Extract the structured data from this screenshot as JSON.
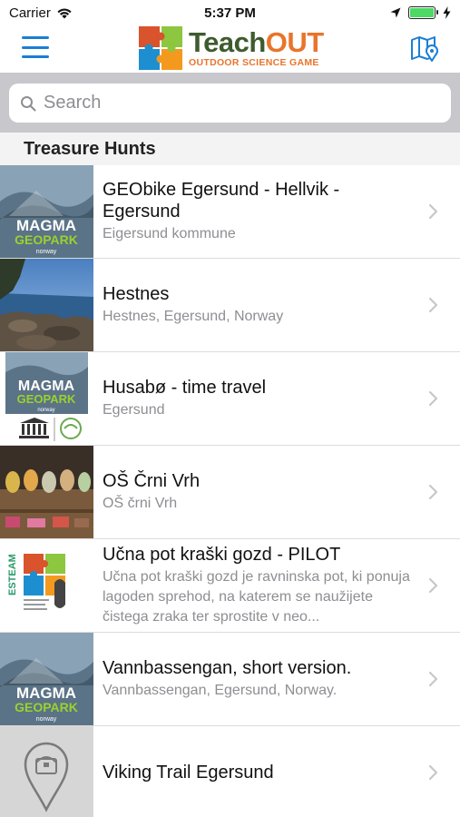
{
  "status": {
    "carrier": "Carrier",
    "time": "5:37 PM"
  },
  "nav": {
    "logo_text_teach": "Teach",
    "logo_text_out": "OUT",
    "logo_subtitle": "OUTDOOR SCIENCE GAME"
  },
  "search": {
    "placeholder": "Search"
  },
  "section": {
    "title": "Treasure Hunts"
  },
  "items": [
    {
      "title": "GEObike Egersund - Hellvik - Egersund",
      "subtitle": "Eigersund kommune",
      "thumb": "magmageopark-logo"
    },
    {
      "title": "Hestnes",
      "subtitle": "Hestnes, Egersund, Norway",
      "thumb": "coast-photo"
    },
    {
      "title": "Husabø - time travel",
      "subtitle": "Egersund",
      "thumb": "magmageopark-unesco-logo"
    },
    {
      "title": "OŠ Črni Vrh",
      "subtitle": "OŠ črni Vrh",
      "thumb": "classroom-photo"
    },
    {
      "title": "Učna pot kraški gozd - PILOT",
      "subtitle": "Učna pot kraški gozd je ravninska pot, ki ponuja lagoden sprehod, na katerem se naužijete čistega zraka ter sprostite v neo...",
      "thumb": "esteam-logo"
    },
    {
      "title": "Vannbassengan, short version.",
      "subtitle": "Vannbassengan, Egersund, Norway.",
      "thumb": "magmageopark-logo"
    },
    {
      "title": "Viking Trail Egersund",
      "subtitle": "",
      "thumb": "map-pin-placeholder"
    }
  ],
  "magma": {
    "line1": "MAGMA",
    "line2": "GEOPARK",
    "line3": "norway"
  },
  "esteam": {
    "label": "ESTEAM"
  },
  "colors": {
    "accent": "#1a7fd4",
    "logo_green": "#3e5b2e",
    "logo_orange": "#e8752b",
    "battery": "#4cd964"
  }
}
